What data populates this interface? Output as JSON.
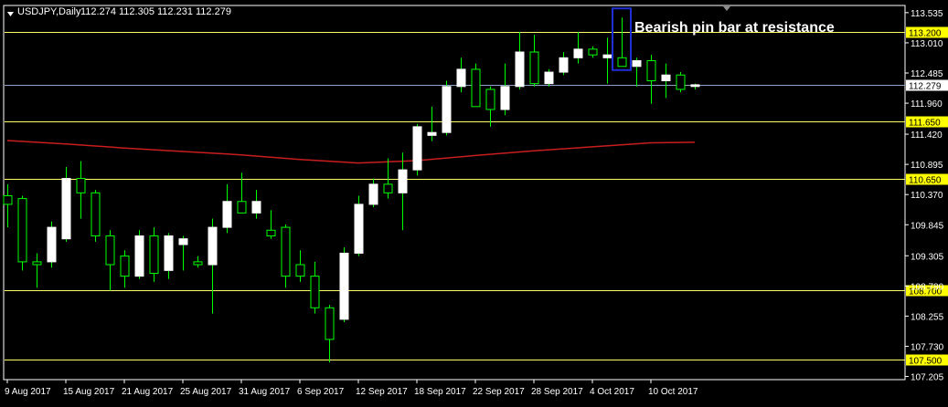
{
  "header": {
    "symbol": "USDJPY,Daily",
    "ohlc": "112.274 112.305 112.231 112.279"
  },
  "annotation": "Bearish pin bar at resistance",
  "colors": {
    "background": "#000000",
    "frame": "#ffffff",
    "bull_candle": "#ffffff",
    "wick": "#00ff00",
    "level_line": "#ffff66",
    "level_label_bg": "#ffff00",
    "price_line": "#8fa3c8",
    "moving_average": "#c81e1e",
    "highlight_box": "#1f2fd6"
  },
  "chart_data": {
    "type": "candlestick",
    "symbol": "USDJPY",
    "timeframe": "Daily",
    "x_labels": [
      "9 Aug 2017",
      "15 Aug 2017",
      "21 Aug 2017",
      "25 Aug 2017",
      "31 Aug 2017",
      "6 Sep 2017",
      "12 Sep 2017",
      "18 Sep 2017",
      "22 Sep 2017",
      "28 Sep 2017",
      "4 Oct 2017",
      "10 Oct 2017"
    ],
    "y_ticks": [
      "113.535",
      "113.010",
      "112.485",
      "111.960",
      "111.420",
      "110.895",
      "110.370",
      "109.845",
      "109.305",
      "108.780",
      "108.255",
      "107.730",
      "107.205"
    ],
    "ylim": [
      107.15,
      113.66
    ],
    "current_price": "112.279",
    "resistance_levels": [
      "113.200",
      "111.650",
      "110.650",
      "108.700",
      "107.500"
    ],
    "candles": [
      {
        "o": 110.35,
        "h": 110.55,
        "l": 109.8,
        "c": 110.2
      },
      {
        "o": 110.3,
        "h": 110.35,
        "l": 109.05,
        "c": 109.2
      },
      {
        "o": 109.2,
        "h": 109.35,
        "l": 108.75,
        "c": 109.15
      },
      {
        "o": 109.2,
        "h": 109.9,
        "l": 109.1,
        "c": 109.8
      },
      {
        "o": 109.6,
        "h": 110.85,
        "l": 109.55,
        "c": 110.65
      },
      {
        "o": 110.65,
        "h": 110.95,
        "l": 109.95,
        "c": 110.4
      },
      {
        "o": 110.4,
        "h": 110.45,
        "l": 109.55,
        "c": 109.65
      },
      {
        "o": 109.65,
        "h": 109.75,
        "l": 108.7,
        "c": 109.15
      },
      {
        "o": 109.3,
        "h": 109.4,
        "l": 108.75,
        "c": 108.95
      },
      {
        "o": 108.95,
        "h": 109.75,
        "l": 108.9,
        "c": 109.65
      },
      {
        "o": 109.65,
        "h": 109.8,
        "l": 108.85,
        "c": 109.0
      },
      {
        "o": 109.05,
        "h": 109.7,
        "l": 108.9,
        "c": 109.65
      },
      {
        "o": 109.5,
        "h": 109.65,
        "l": 109.05,
        "c": 109.6
      },
      {
        "o": 109.2,
        "h": 109.3,
        "l": 109.1,
        "c": 109.15
      },
      {
        "o": 109.15,
        "h": 109.95,
        "l": 108.3,
        "c": 109.8
      },
      {
        "o": 109.8,
        "h": 110.55,
        "l": 109.7,
        "c": 110.25
      },
      {
        "o": 110.25,
        "h": 110.75,
        "l": 110.05,
        "c": 110.05
      },
      {
        "o": 110.05,
        "h": 110.45,
        "l": 109.95,
        "c": 110.25
      },
      {
        "o": 109.75,
        "h": 110.1,
        "l": 109.6,
        "c": 109.65
      },
      {
        "o": 109.8,
        "h": 109.85,
        "l": 108.75,
        "c": 108.95
      },
      {
        "o": 109.15,
        "h": 109.4,
        "l": 108.85,
        "c": 108.95
      },
      {
        "o": 108.95,
        "h": 109.2,
        "l": 108.3,
        "c": 108.4
      },
      {
        "o": 108.4,
        "h": 108.45,
        "l": 107.45,
        "c": 107.85
      },
      {
        "o": 108.2,
        "h": 109.45,
        "l": 108.15,
        "c": 109.35
      },
      {
        "o": 109.35,
        "h": 110.35,
        "l": 109.3,
        "c": 110.2
      },
      {
        "o": 110.2,
        "h": 110.65,
        "l": 110.15,
        "c": 110.55
      },
      {
        "o": 110.55,
        "h": 111.0,
        "l": 110.3,
        "c": 110.4
      },
      {
        "o": 110.4,
        "h": 111.1,
        "l": 109.75,
        "c": 110.8
      },
      {
        "o": 110.8,
        "h": 111.6,
        "l": 110.7,
        "c": 111.55
      },
      {
        "o": 111.4,
        "h": 111.9,
        "l": 111.3,
        "c": 111.45
      },
      {
        "o": 111.45,
        "h": 112.35,
        "l": 111.4,
        "c": 112.25
      },
      {
        "o": 112.25,
        "h": 112.75,
        "l": 112.15,
        "c": 112.55
      },
      {
        "o": 112.55,
        "h": 112.65,
        "l": 111.9,
        "c": 111.9
      },
      {
        "o": 112.2,
        "h": 112.25,
        "l": 111.55,
        "c": 111.85
      },
      {
        "o": 111.85,
        "h": 112.65,
        "l": 111.75,
        "c": 112.25
      },
      {
        "o": 112.25,
        "h": 113.2,
        "l": 112.2,
        "c": 112.85
      },
      {
        "o": 112.85,
        "h": 113.15,
        "l": 112.25,
        "c": 112.3
      },
      {
        "o": 112.3,
        "h": 112.55,
        "l": 112.25,
        "c": 112.5
      },
      {
        "o": 112.5,
        "h": 112.85,
        "l": 112.45,
        "c": 112.75
      },
      {
        "o": 112.75,
        "h": 113.2,
        "l": 112.65,
        "c": 112.9
      },
      {
        "o": 112.9,
        "h": 112.95,
        "l": 112.75,
        "c": 112.8
      },
      {
        "o": 112.75,
        "h": 113.1,
        "l": 112.3,
        "c": 112.8
      },
      {
        "o": 112.75,
        "h": 113.45,
        "l": 112.6,
        "c": 112.6
      },
      {
        "o": 112.6,
        "h": 112.75,
        "l": 112.25,
        "c": 112.7
      },
      {
        "o": 112.7,
        "h": 112.8,
        "l": 111.95,
        "c": 112.35
      },
      {
        "o": 112.35,
        "h": 112.65,
        "l": 112.05,
        "c": 112.45
      },
      {
        "o": 112.45,
        "h": 112.5,
        "l": 112.15,
        "c": 112.2
      },
      {
        "o": 112.25,
        "h": 112.3,
        "l": 112.2,
        "c": 112.28
      }
    ],
    "moving_average": [
      {
        "i": 0,
        "v": 111.31
      },
      {
        "i": 4,
        "v": 111.25
      },
      {
        "i": 8,
        "v": 111.18
      },
      {
        "i": 12,
        "v": 111.12
      },
      {
        "i": 16,
        "v": 111.06
      },
      {
        "i": 20,
        "v": 110.98
      },
      {
        "i": 24,
        "v": 110.92
      },
      {
        "i": 28,
        "v": 110.96
      },
      {
        "i": 32,
        "v": 111.05
      },
      {
        "i": 36,
        "v": 111.13
      },
      {
        "i": 40,
        "v": 111.2
      },
      {
        "i": 44,
        "v": 111.27
      },
      {
        "i": 47,
        "v": 111.28
      }
    ],
    "highlighted_candle_index": 42
  }
}
